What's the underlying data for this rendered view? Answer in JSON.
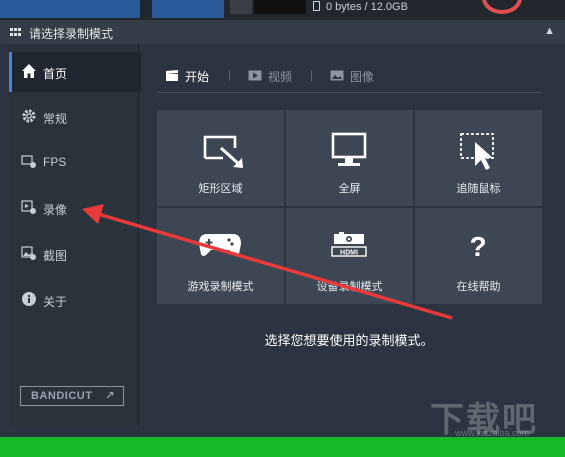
{
  "top": {
    "file_info": "0 bytes / 12.0GB"
  },
  "titlebar": {
    "title": "请选择录制模式",
    "collapse_icon": "chevron-up-icon"
  },
  "sidebar": {
    "items": [
      {
        "label": "首页",
        "icon": "home-icon",
        "active": true
      },
      {
        "label": "常规",
        "icon": "gear-icon"
      },
      {
        "label": "FPS",
        "icon": "fps-icon"
      },
      {
        "label": "录像",
        "icon": "video-gear-icon"
      },
      {
        "label": "截图",
        "icon": "image-gear-icon"
      },
      {
        "label": "关于",
        "icon": "info-icon"
      }
    ],
    "brand": "BANDICUT"
  },
  "tabs": [
    {
      "label": "开始",
      "icon": "clapperboard-icon",
      "active": true
    },
    {
      "label": "视频",
      "icon": "play-icon"
    },
    {
      "label": "图像",
      "icon": "picture-icon"
    }
  ],
  "modes": [
    {
      "label": "矩形区域",
      "icon": "rectangle-area-icon"
    },
    {
      "label": "全屏",
      "icon": "monitor-icon"
    },
    {
      "label": "追随鼠标",
      "icon": "cursor-follow-icon"
    },
    {
      "label": "游戏录制模式",
      "icon": "gamepad-icon"
    },
    {
      "label": "设备录制模式",
      "icon": "hdmi-device-icon"
    },
    {
      "label": "在线帮助",
      "icon": "question-icon"
    }
  ],
  "hint": "选择您想要使用的录制模式。",
  "watermark": {
    "text": "下载吧",
    "url": "www.xiazaiba.com"
  },
  "colors": {
    "accent_blue": "#3d8be0",
    "tile_bg": "#3d4753",
    "annotation_red": "#e83a3a",
    "green_bar": "#17b82a"
  }
}
